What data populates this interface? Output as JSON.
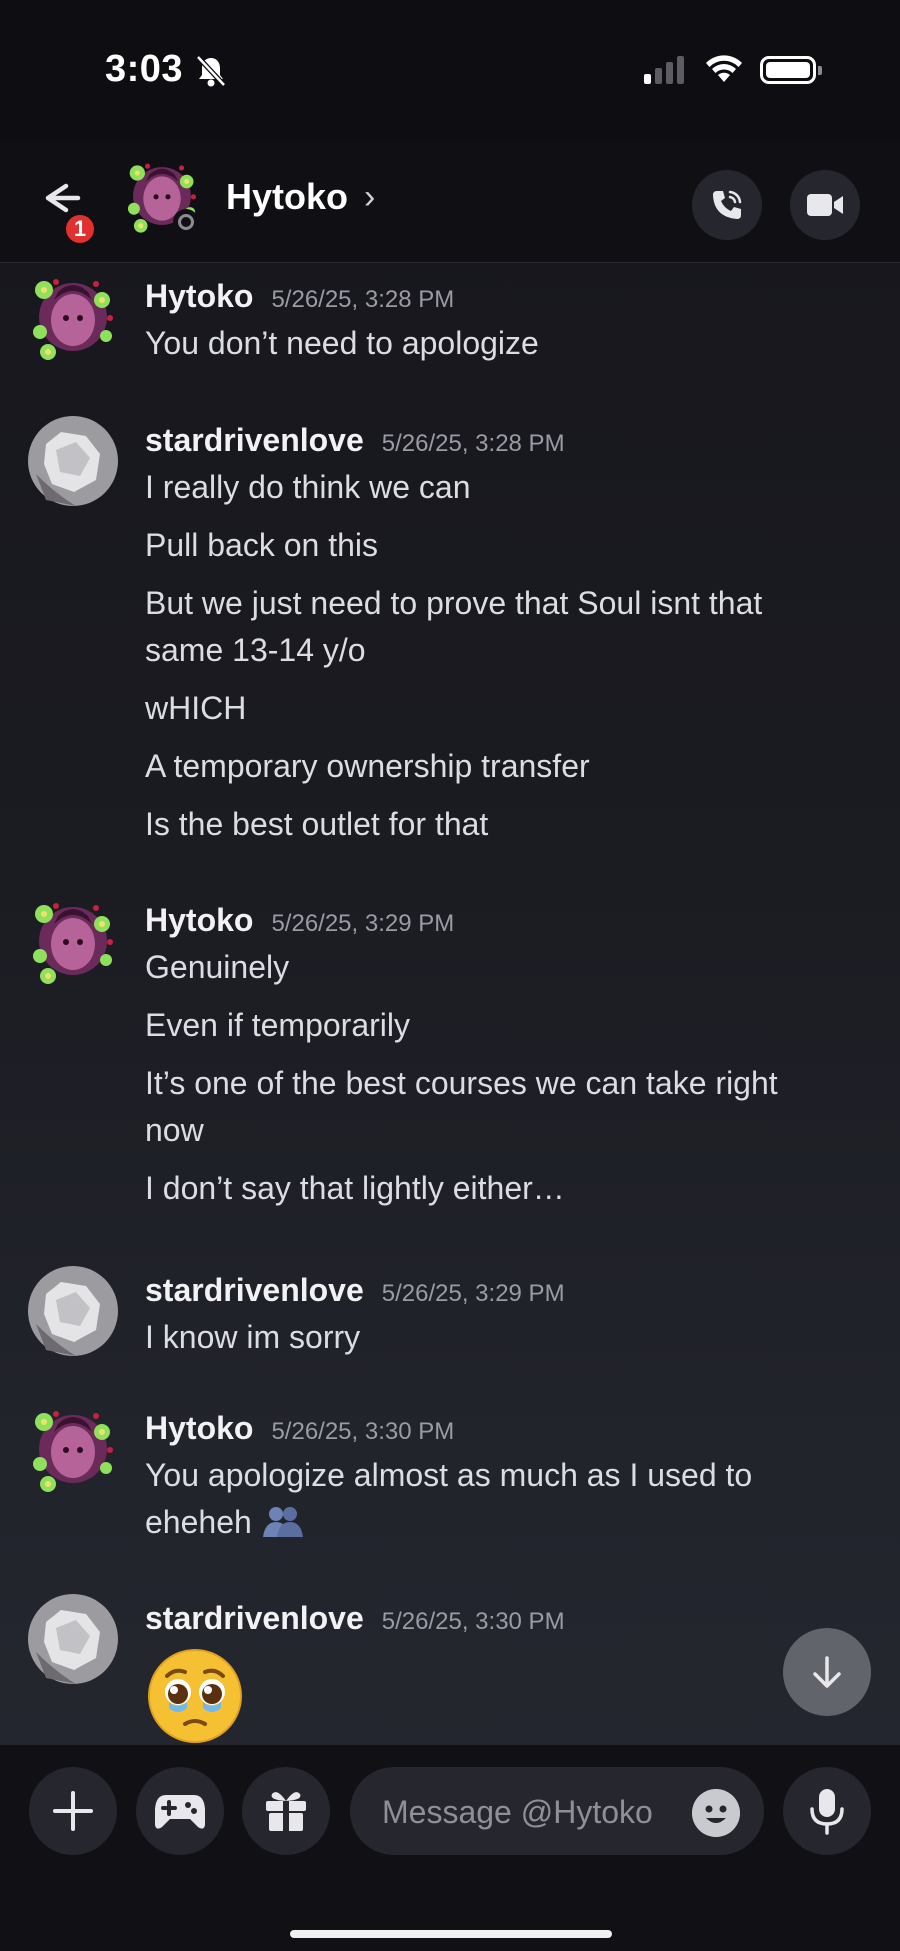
{
  "status_bar": {
    "time": "3:03"
  },
  "header": {
    "name": "Hytoko",
    "chevron": "›",
    "unread_badge": "1",
    "icons": [
      "back-arrow-icon",
      "phone-call-icon",
      "video-camera-icon"
    ]
  },
  "messages": [
    {
      "author": "Hytoko",
      "time": "5/26/25, 3:28 PM",
      "lines": [
        "You don’t need to apologize"
      ]
    },
    {
      "author": "stardrivenlove",
      "time": "5/26/25, 3:28 PM",
      "lines": [
        "I really do think we can",
        "Pull back on this",
        "But we just need to prove that Soul isnt that same 13-14 y/o",
        "wHICH",
        "A temporary ownership transfer",
        "Is the best outlet for that"
      ]
    },
    {
      "author": "Hytoko",
      "time": "5/26/25, 3:29 PM",
      "lines": [
        "Genuinely",
        "Even if temporarily",
        "It’s one of the best courses we can take right now",
        "I don’t say that lightly either…"
      ]
    },
    {
      "author": "stardrivenlove",
      "time": "5/26/25, 3:29 PM",
      "lines": [
        "I know im sorry"
      ]
    },
    {
      "author": "Hytoko",
      "time": "5/26/25, 3:30 PM",
      "lines": [
        "You apologize almost as much as I used to eheheh"
      ],
      "inline_emoji": "hugging-people-emoji"
    },
    {
      "author": "stardrivenlove",
      "time": "5/26/25, 3:30 PM",
      "emoji": "pleading-face-emoji"
    }
  ],
  "composer": {
    "placeholder": "Message @Hytoko",
    "buttons": [
      "plus-icon",
      "gamepad-icon",
      "gift-icon",
      "emoji-icon",
      "microphone-icon"
    ]
  },
  "colors": {
    "background": "#1b1c22",
    "header": "#0f0f14",
    "badge": "#e0312f",
    "button": "#26272e"
  }
}
